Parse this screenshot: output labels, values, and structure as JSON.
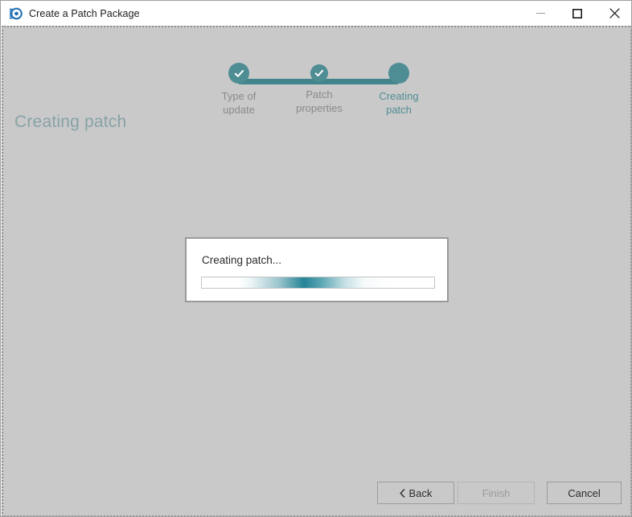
{
  "window": {
    "title": "Create a Patch Package",
    "app_icon": "app-logo-icon",
    "controls": {
      "minimize_label": "Minimize",
      "maximize_label": "Maximize",
      "close_label": "Close"
    }
  },
  "wizard": {
    "steps": [
      {
        "label": "Type of\nupdate",
        "state": "completed",
        "icon": "check-icon"
      },
      {
        "label": "Patch\nproperties",
        "state": "completed",
        "icon": "check-icon"
      },
      {
        "label": "Creating\npatch",
        "state": "current",
        "icon": "dot-icon"
      }
    ]
  },
  "page": {
    "title": "Creating patch"
  },
  "modal": {
    "message": "Creating patch...",
    "progress": {
      "type": "indeterminate",
      "position_percent": 45
    }
  },
  "footer": {
    "back_label": "Back",
    "back_icon": "chevron-left-icon",
    "finish_label": "Finish",
    "cancel_label": "Cancel"
  },
  "colors": {
    "accent": "#4f8d94",
    "rail": "#42848c",
    "background": "#c9c9c9",
    "heading": "#87a2a6",
    "muted_label": "#8a8a8a",
    "progress_blob": "#197d91"
  }
}
